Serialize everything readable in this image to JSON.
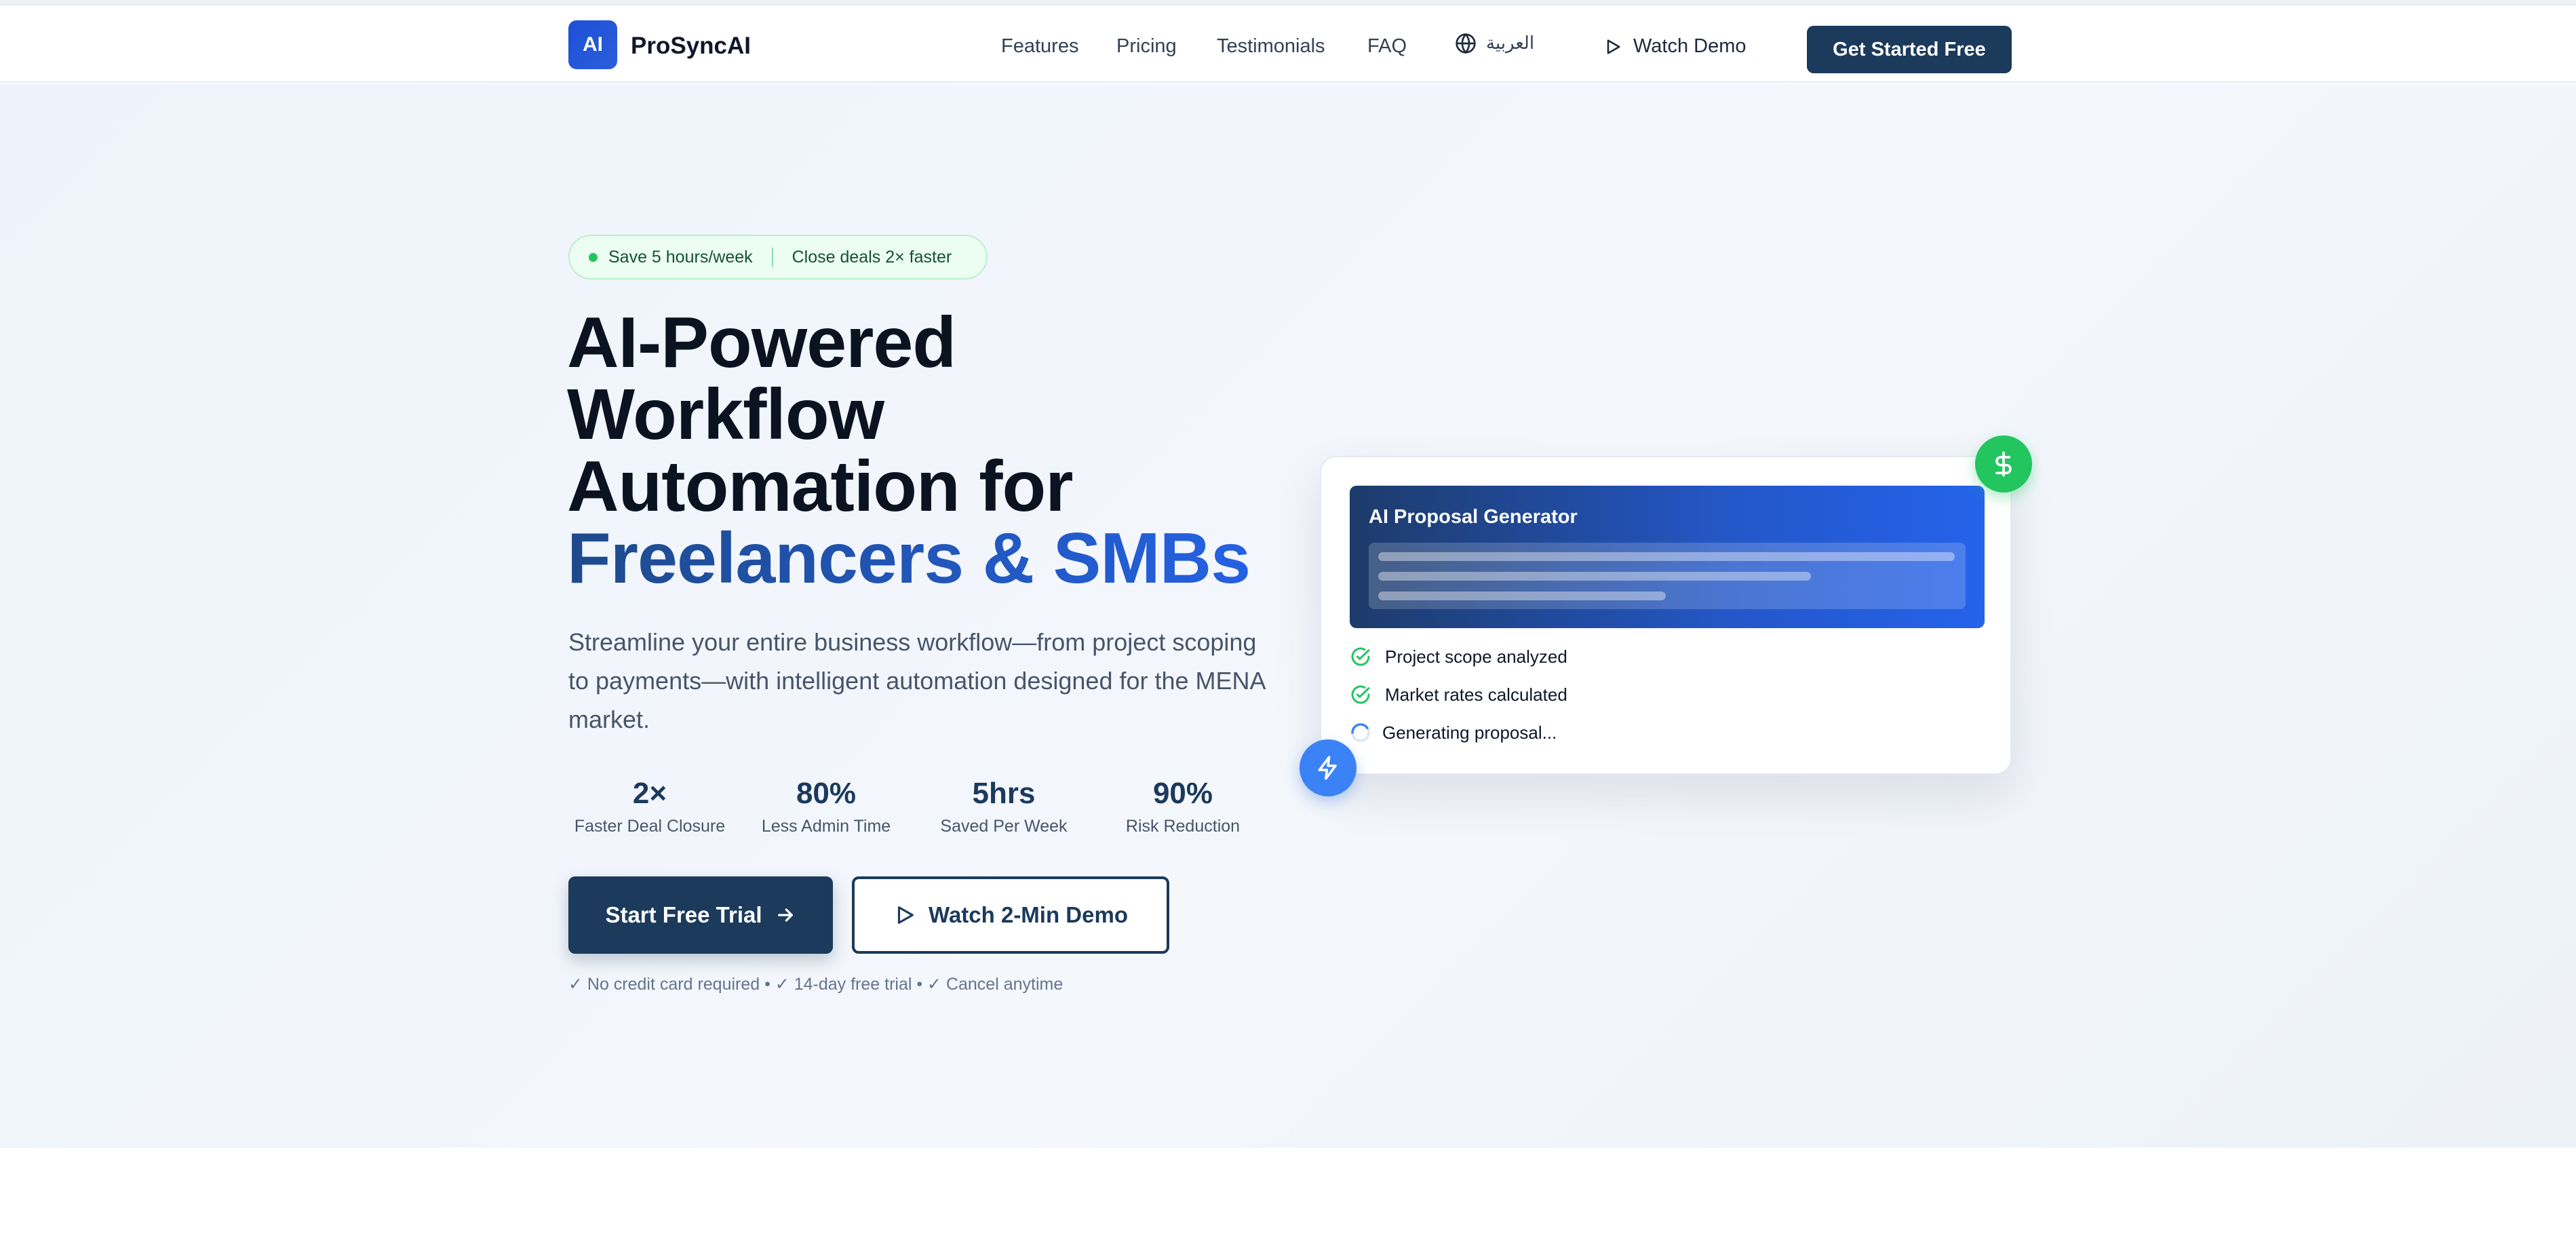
{
  "header": {
    "logo_text": "AI",
    "brand": "ProSyncAI",
    "nav": [
      "Features",
      "Pricing",
      "Testimonials",
      "FAQ"
    ],
    "language": "العربية",
    "watch_demo": "Watch Demo",
    "cta": "Get Started Free"
  },
  "hero": {
    "badge": {
      "left": "Save 5 hours/week",
      "right": "Close deals 2× faster"
    },
    "headline": {
      "line1": "AI-Powered",
      "line2": "Workflow",
      "line3": "Automation for",
      "accent": "Freelancers & SMBs"
    },
    "subtitle": "Streamline your entire business workflow—from project scoping to payments—with intelligent automation designed for the MENA market.",
    "stats": [
      {
        "value": "2×",
        "label": "Faster Deal Closure"
      },
      {
        "value": "80%",
        "label": "Less Admin Time"
      },
      {
        "value": "5hrs",
        "label": "Saved Per Week"
      },
      {
        "value": "90%",
        "label": "Risk Reduction"
      }
    ],
    "primary_button": "Start Free Trial",
    "secondary_button": "Watch 2-Min Demo",
    "fine_print": "✓ No credit card required • ✓ 14-day free trial • ✓ Cancel anytime"
  },
  "card": {
    "title": "AI Proposal Generator",
    "steps": [
      {
        "label": "Project scope analyzed",
        "status": "done"
      },
      {
        "label": "Market rates calculated",
        "status": "done"
      },
      {
        "label": "Generating proposal...",
        "status": "loading"
      }
    ]
  },
  "colors": {
    "primary": "#1b3a5c",
    "accent_blue": "#2563eb",
    "success_green": "#22c55e"
  },
  "icons": {
    "language": "globe-icon",
    "play": "play-icon",
    "arrow": "arrow-right-icon",
    "check": "check-circle-icon",
    "spinner": "spinner-icon",
    "dollar": "dollar-icon",
    "bolt": "lightning-icon"
  }
}
